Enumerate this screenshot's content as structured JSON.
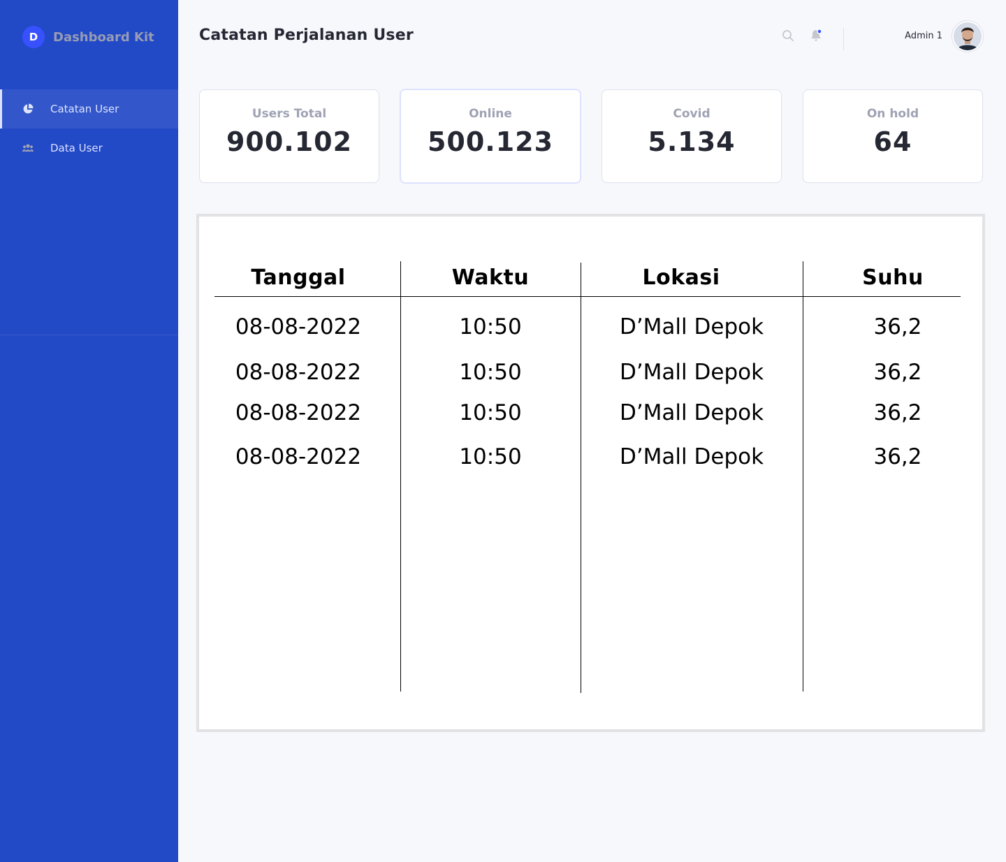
{
  "sidebar": {
    "logo_letter": "D",
    "brand_name": "Dashboard Kit",
    "items": [
      {
        "label": "Catatan User",
        "icon": "pie-chart-icon",
        "active": true
      },
      {
        "label": "Data User",
        "icon": "users-icon",
        "active": false
      }
    ]
  },
  "header": {
    "title": "Catatan Perjalanan User",
    "search_icon": "search-icon",
    "notification_icon": "bell-icon",
    "user_name": "Admin 1"
  },
  "stats": [
    {
      "label": "Users Total",
      "value": "900.102"
    },
    {
      "label": "Online",
      "value": "500.123"
    },
    {
      "label": "Covid",
      "value": "5.134"
    },
    {
      "label": "On hold",
      "value": "64"
    }
  ],
  "table": {
    "columns": [
      "Tanggal",
      "Waktu",
      "Lokasi",
      "Suhu"
    ],
    "rows": [
      [
        "08-08-2022",
        "10:50",
        "D’Mall Depok",
        "36,2"
      ],
      [
        "08-08-2022",
        "10:50",
        "D’Mall Depok",
        "36,2"
      ],
      [
        "08-08-2022",
        "10:50",
        "D’Mall Depok",
        "36,2"
      ],
      [
        "08-08-2022",
        "10:50",
        "D’Mall Depok",
        "36,2"
      ]
    ]
  },
  "colors": {
    "sidebar": "#2249C6",
    "accent": "#3751FF",
    "background": "#F7F8FC",
    "muted_text": "#9FA2B4"
  }
}
